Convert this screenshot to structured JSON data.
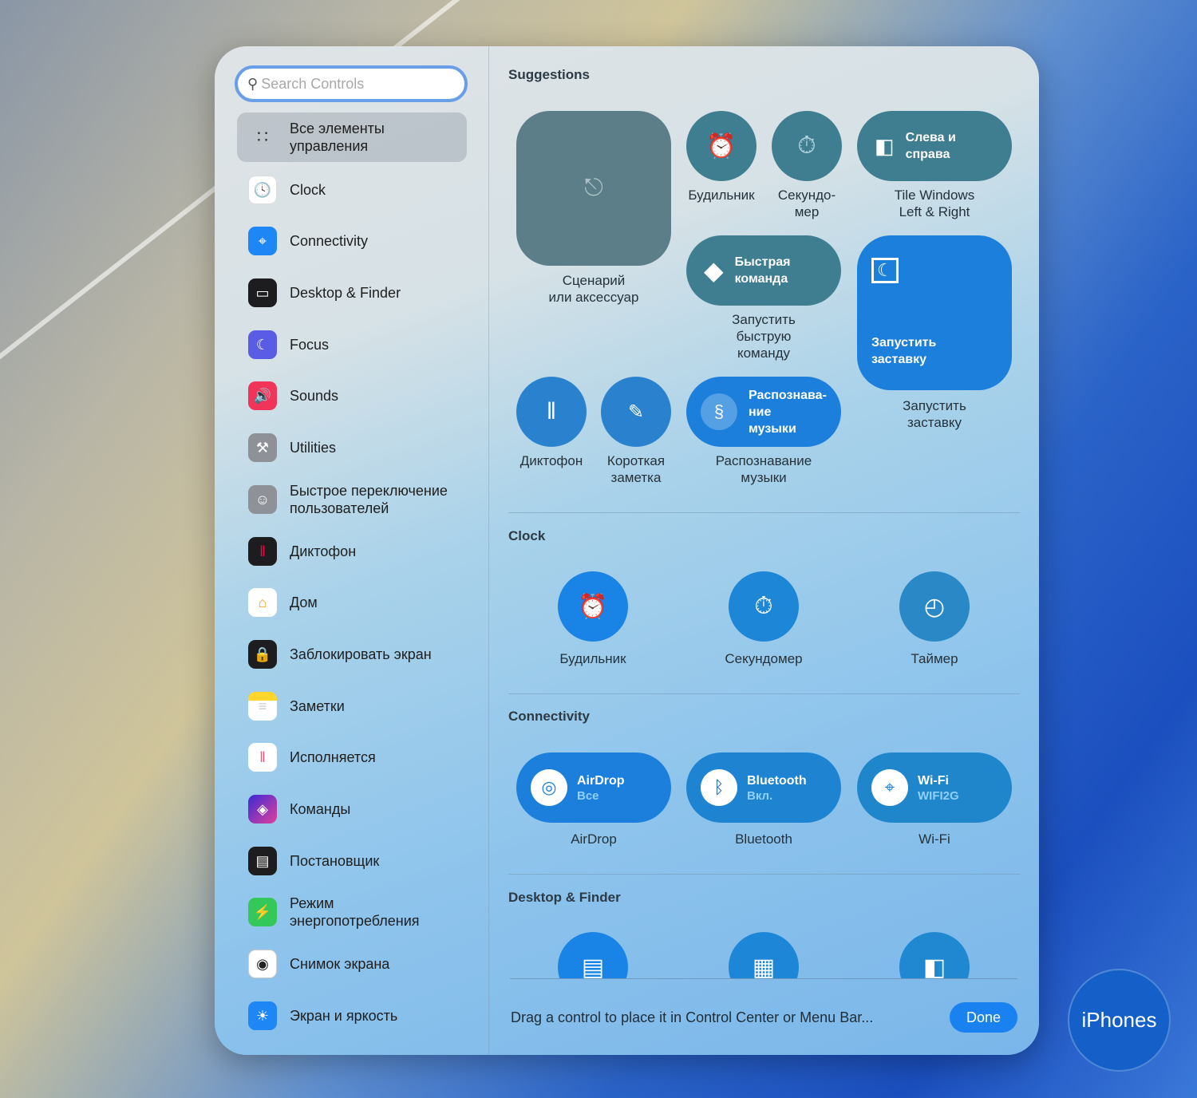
{
  "search": {
    "placeholder": "Search Controls"
  },
  "sidebar": {
    "items": [
      {
        "label": "Все элементы управления",
        "icon": "grid-icon"
      },
      {
        "label": "Clock",
        "icon": "clock-icon"
      },
      {
        "label": "Connectivity",
        "icon": "wifi-icon"
      },
      {
        "label": "Desktop & Finder",
        "icon": "desktop-icon"
      },
      {
        "label": "Focus",
        "icon": "moon-icon"
      },
      {
        "label": "Sounds",
        "icon": "speaker-icon"
      },
      {
        "label": "Utilities",
        "icon": "tools-icon"
      },
      {
        "label": "Быстрое переключение пользователей",
        "icon": "user-icon"
      },
      {
        "label": "Диктофон",
        "icon": "waveform-icon"
      },
      {
        "label": "Дом",
        "icon": "home-icon"
      },
      {
        "label": "Заблокировать экран",
        "icon": "lock-icon"
      },
      {
        "label": "Заметки",
        "icon": "notes-icon"
      },
      {
        "label": "Исполняется",
        "icon": "now-playing-icon"
      },
      {
        "label": "Команды",
        "icon": "shortcuts-icon"
      },
      {
        "label": "Постановщик",
        "icon": "stage-manager-icon"
      },
      {
        "label": "Режим энергопотребления",
        "icon": "battery-bolt-icon"
      },
      {
        "label": "Снимок экрана",
        "icon": "screenshot-icon"
      },
      {
        "label": "Экран и яркость",
        "icon": "brightness-icon"
      }
    ]
  },
  "suggestions": {
    "title": "Suggestions",
    "scene": {
      "label": "Сценарий\nили аксессуар"
    },
    "alarm": {
      "label": "Будильник"
    },
    "stopwatch": {
      "label": "Секундо-\nмер"
    },
    "tile": {
      "text": "Слева и\nсправа",
      "label": "Tile Windows\nLeft & Right"
    },
    "shortcut": {
      "text": "Быстрая\nкоманда",
      "label": "Запустить\nбыструю\nкоманду"
    },
    "screensaver": {
      "text": "Запустить\nзаставку",
      "label": "Запустить\nзаставку"
    },
    "voice": {
      "label": "Диктофон"
    },
    "note": {
      "label": "Короткая\nзаметка"
    },
    "music": {
      "text": "Распознава-\nние\nмузыки",
      "label": "Распознавание\nмузыки"
    }
  },
  "clock": {
    "title": "Clock",
    "items": [
      "Будильник",
      "Секундомер",
      "Таймер"
    ]
  },
  "connectivity": {
    "title": "Connectivity",
    "items": [
      {
        "name": "AirDrop",
        "status": "Все",
        "label": "AirDrop"
      },
      {
        "name": "Bluetooth",
        "status": "Вкл.",
        "label": "Bluetooth"
      },
      {
        "name": "Wi-Fi",
        "status": "WIFI2G",
        "label": "Wi-Fi"
      }
    ]
  },
  "desktop": {
    "title": "Desktop & Finder"
  },
  "footer": {
    "hint": "Drag a control to place it in Control Center or Menu Bar...",
    "done": "Done"
  },
  "watermark": "iPhones"
}
